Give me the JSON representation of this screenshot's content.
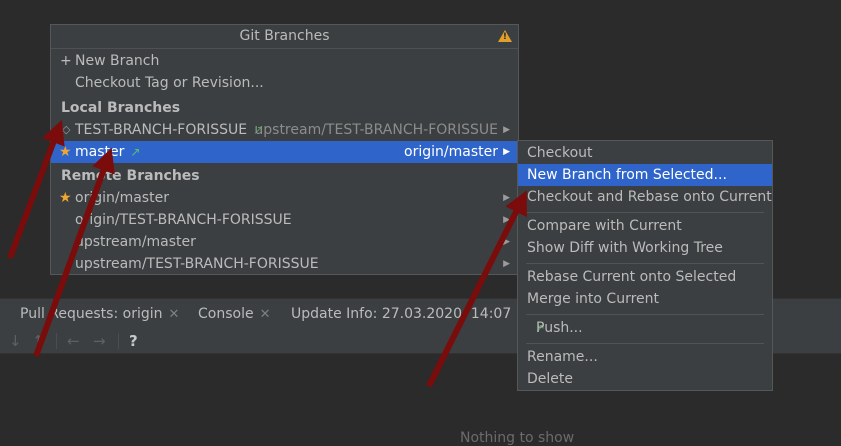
{
  "popup": {
    "title": "Git Branches",
    "warning_icon": "warning-icon",
    "actions": [
      {
        "label": "New Branch",
        "icon": "plus-icon"
      },
      {
        "label": "Checkout Tag or Revision..."
      }
    ],
    "local_header": "Local Branches",
    "local_branches": [
      {
        "name": "TEST-BRANCH-FORISSUE",
        "tracking": "upstream/TEST-BRANCH-FORISSUE",
        "icon": "diamond-icon",
        "outgoing": true
      },
      {
        "name": "master",
        "tracking": "origin/master",
        "icon": "star-icon",
        "outgoing": true,
        "selected": true
      }
    ],
    "remote_header": "Remote Branches",
    "remote_branches": [
      {
        "name": "origin/master",
        "icon": "star-icon"
      },
      {
        "name": "origin/TEST-BRANCH-FORISSUE"
      },
      {
        "name": "upstream/master"
      },
      {
        "name": "upstream/TEST-BRANCH-FORISSUE"
      }
    ]
  },
  "submenu": {
    "items": [
      {
        "label": "Checkout"
      },
      {
        "label": "New Branch from Selected...",
        "selected": true
      },
      {
        "label": "Checkout and Rebase onto Current"
      },
      {
        "label": "Compare with Current"
      },
      {
        "label": "Show Diff with Working Tree"
      },
      {
        "label": "Rebase Current onto Selected"
      },
      {
        "label": "Merge into Current"
      },
      {
        "label": "Push..."
      },
      {
        "label": "Rename..."
      },
      {
        "label": "Delete"
      }
    ]
  },
  "tool_window": {
    "tabs": [
      {
        "label": "Pull Requests: origin"
      },
      {
        "label": "Console"
      },
      {
        "label": "Update Info: 27.03.2020, 14:07"
      }
    ],
    "toolbar": {
      "help_label": "?"
    },
    "empty_text": "Nothing to show"
  },
  "colors": {
    "background": "#2b2b2b",
    "panel": "#3c3f41",
    "selection": "#2f65ca",
    "star": "#f0a732",
    "outgoing_arrow": "#4ea653",
    "annotation_arrow": "#7a0c0c"
  }
}
